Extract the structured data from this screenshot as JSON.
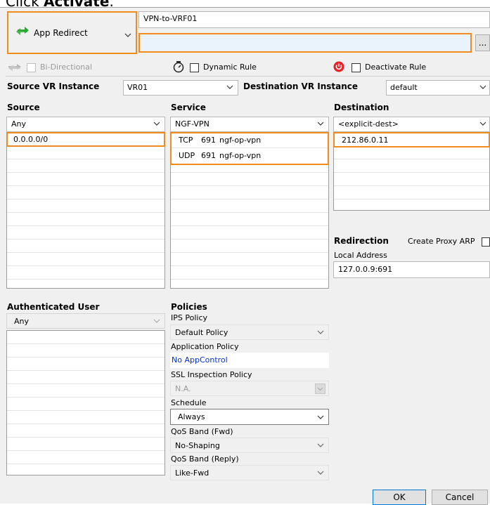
{
  "caption": {
    "prefix": "Click ",
    "action": "Activate",
    "suffix": "."
  },
  "rule": {
    "action_label": "App Redirect",
    "name": "VPN-to-VRF01",
    "description": "",
    "more_button": "..."
  },
  "options": {
    "bidirectional": "Bi-Directional",
    "dynamic_rule": "Dynamic Rule",
    "deactivate_rule": "Deactivate Rule"
  },
  "vr": {
    "source_label": "Source VR Instance",
    "source_value": "VR01",
    "destination_label": "Destination VR Instance",
    "destination_value": "default"
  },
  "source": {
    "header": "Source",
    "selected": "Any",
    "items": [
      "0.0.0.0/0"
    ]
  },
  "service": {
    "header": "Service",
    "selected": "NGF-VPN",
    "items": [
      {
        "proto": "TCP",
        "port": "691",
        "name": "ngf-op-vpn"
      },
      {
        "proto": "UDP",
        "port": "691",
        "name": "ngf-op-vpn"
      }
    ]
  },
  "destination": {
    "header": "Destination",
    "selected": "<explicit-dest>",
    "items": [
      "212.86.0.11"
    ]
  },
  "redirection": {
    "header": "Redirection",
    "proxy_arp": "Create Proxy ARP",
    "local_address_label": "Local Address",
    "local_address": "127.0.0.9:691"
  },
  "auth": {
    "header": "Authenticated User",
    "selected": "Any"
  },
  "policies": {
    "header": "Policies",
    "ips_label": "IPS Policy",
    "ips_value": "Default Policy",
    "app_label": "Application Policy",
    "app_value": "No AppControl",
    "ssl_label": "SSL Inspection Policy",
    "ssl_value": "N.A.",
    "schedule_label": "Schedule",
    "schedule_value": "Always",
    "qos_fwd_label": "QoS Band (Fwd)",
    "qos_fwd_value": "No-Shaping",
    "qos_reply_label": "QoS Band (Reply)",
    "qos_reply_value": "Like-Fwd"
  },
  "buttons": {
    "ok": "OK",
    "cancel": "Cancel"
  },
  "colors": {
    "highlight": "#f08c1e",
    "link": "#0033cc",
    "deactivate": "#e8202a",
    "redirect_icon": "#2aa832"
  }
}
